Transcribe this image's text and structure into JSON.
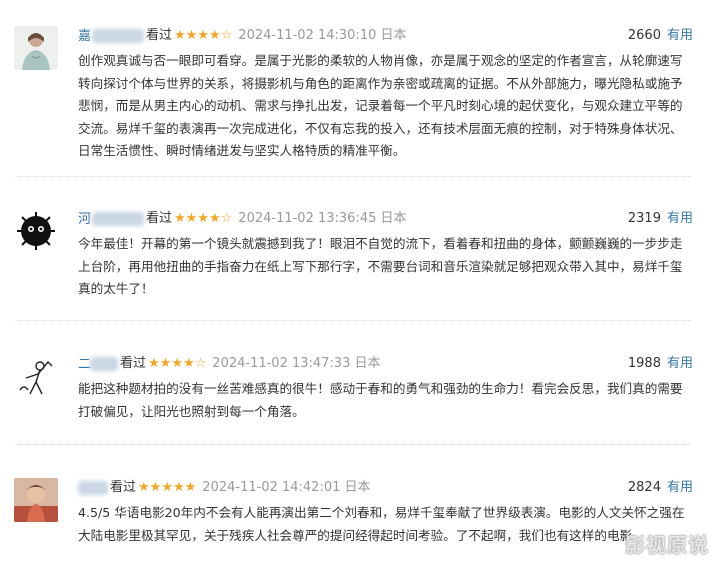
{
  "reviews": [
    {
      "user": "嘉",
      "watched": "看过",
      "stars": "★★★★☆",
      "time": "2024-11-02 14:30:10 日本",
      "votes": "2660",
      "useful": "有用",
      "text": "创作观真诚与否一眼即可看穿。是属于光影的柔软的人物肖像，亦是属于观念的坚定的作者宣言，从轮廓速写转向探讨个体与世界的关系，将摄影机与角色的距离作为亲密或疏离的证据。不从外部施力，曝光隐私或施予悲悯，而是从男主内心的动机、需求与挣扎出发，记录着每一个平凡时刻心境的起伏变化，与观众建立平等的交流。易烊千玺的表演再一次完成进化，不仅有忘我的投入，还有技术层面无痕的控制，对于特殊身体状况、日常生活惯性、瞬时情绪迸发与坚实人格特质的精准平衡。"
    },
    {
      "user": "河",
      "watched": "看过",
      "stars": "★★★★☆",
      "time": "2024-11-02 13:36:45 日本",
      "votes": "2319",
      "useful": "有用",
      "text": "今年最佳！开幕的第一个镜头就震撼到我了！眼泪不自觉的流下，看着春和扭曲的身体，颤颤巍巍的一步步走上台阶，再用他扭曲的手指奋力在纸上写下那行字，不需要台词和音乐渲染就足够把观众带入其中，易烊千玺真的太牛了！"
    },
    {
      "user": "二",
      "watched": "看过",
      "stars": "★★★★☆",
      "time": "2024-11-02 13:47:33 日本",
      "votes": "1988",
      "useful": "有用",
      "text": "能把这种题材拍的没有一丝苦难感真的很牛！感动于春和的勇气和强劲的生命力！看完会反思，我们真的需要打破偏见，让阳光也照射到每一个角落。"
    },
    {
      "user": "",
      "watched": "看过",
      "stars": "★★★★★",
      "time": "2024-11-02 14:42:01 日本",
      "votes": "2824",
      "useful": "有用",
      "text": "4.5/5 华语电影20年内不会有人能再演出第二个刘春和，易烊千玺奉献了世界级表演。电影的人文关怀之强在大陆电影里极其罕见，关于残疾人社会尊严的提问经得起时间考验。了不起啊，我们也有这样的电影"
    }
  ],
  "watermark": "影视原说"
}
